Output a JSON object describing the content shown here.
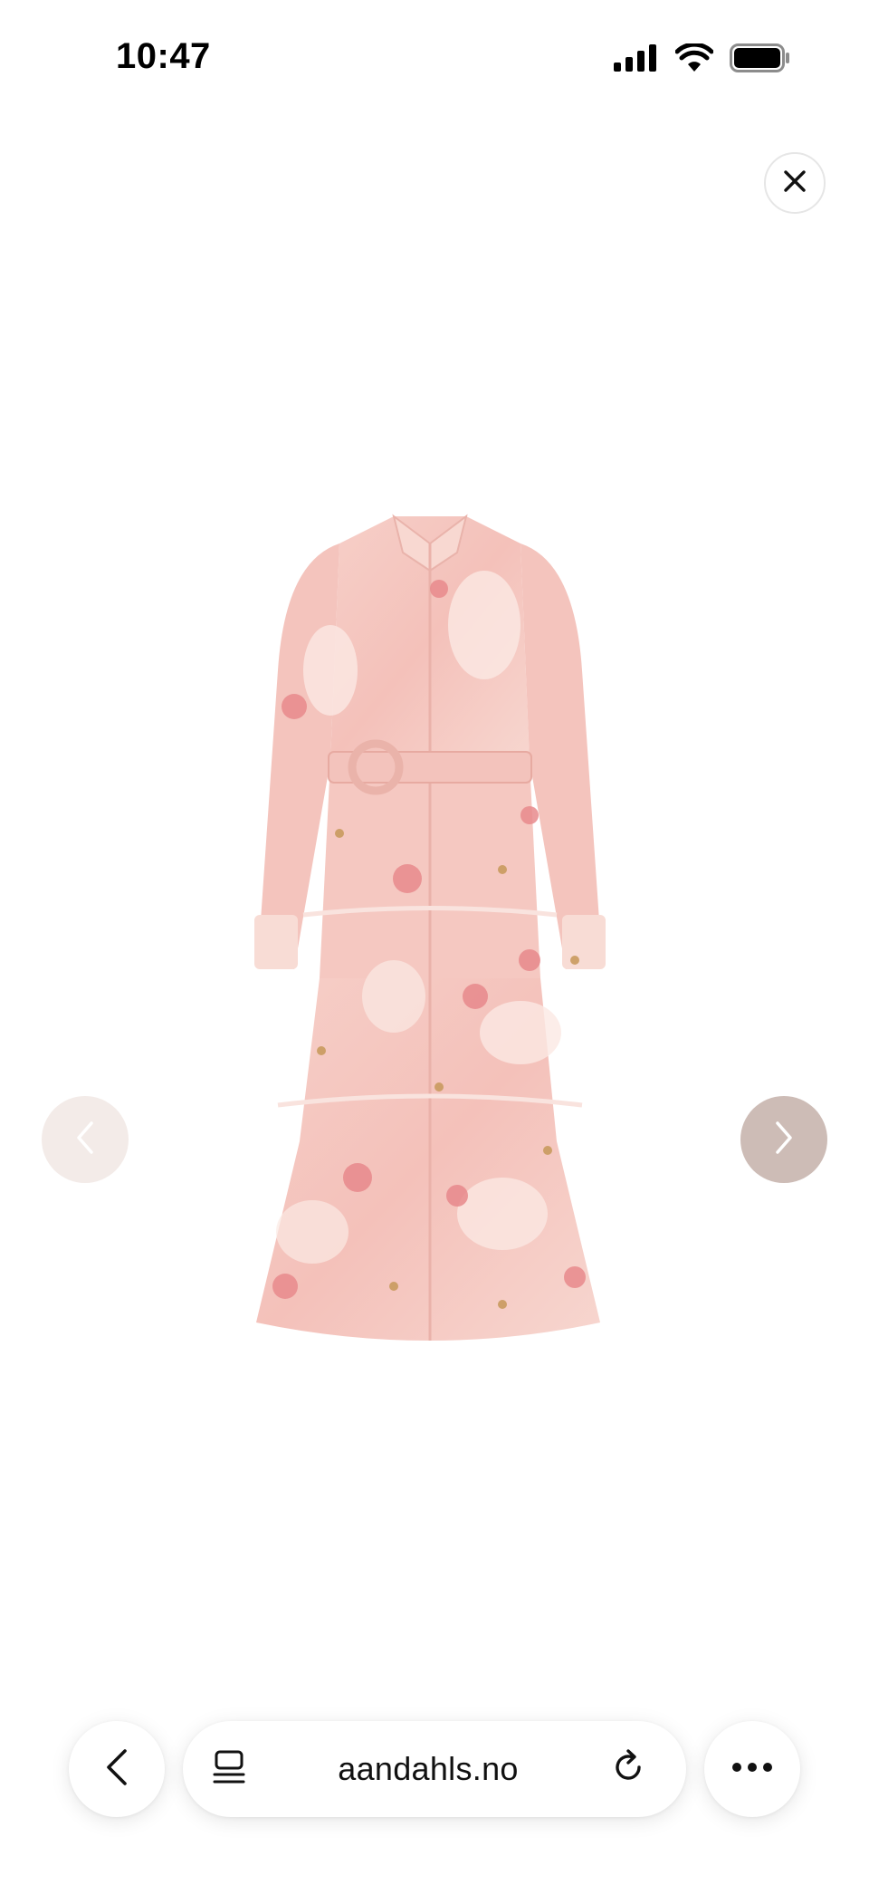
{
  "status_bar": {
    "time": "10:47",
    "icons": [
      "signal-icon",
      "wifi-icon",
      "battery-icon"
    ]
  },
  "viewer": {
    "close_icon": "close-icon",
    "image_description": "pink floral belted tiered midi shirt dress",
    "prev_icon": "chevron-left-icon",
    "next_icon": "chevron-right-icon"
  },
  "toolbar": {
    "url": "aandahls.no",
    "back_icon": "chevron-left-icon",
    "tabs_icon": "reader-icon",
    "reload_icon": "reload-icon",
    "more_icon": "more-icon"
  },
  "colors": {
    "dress_base": "#f4c7c0",
    "dress_light": "#fbe3dc",
    "flower": "#e88c8f",
    "accent_gold": "#c79a5a",
    "prev_button": "#f3ebe8",
    "next_button": "#cdbcb6"
  }
}
